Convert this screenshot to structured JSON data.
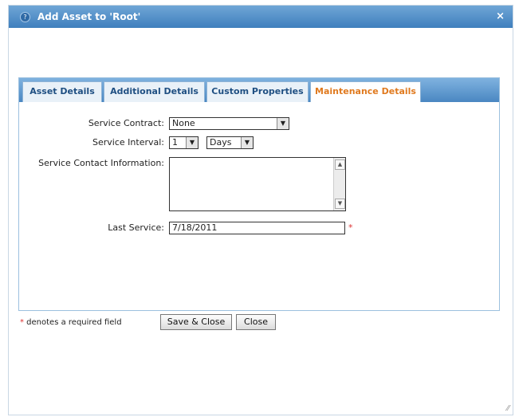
{
  "dialog": {
    "title": "Add Asset to 'Root'",
    "help_icon": "question-circle-icon",
    "close_label": "×"
  },
  "tabs": [
    {
      "label": "Asset Details",
      "active": false
    },
    {
      "label": "Additional Details",
      "active": false
    },
    {
      "label": "Custom Properties",
      "active": false
    },
    {
      "label": "Maintenance Details",
      "active": true
    }
  ],
  "form": {
    "service_contract": {
      "label": "Service Contract:",
      "value": "None"
    },
    "service_interval": {
      "label": "Service Interval:",
      "value": "1",
      "unit": "Days"
    },
    "service_contact": {
      "label": "Service Contact Information:",
      "value": ""
    },
    "last_service": {
      "label": "Last Service:",
      "value": "7/18/2011",
      "required_mark": "*"
    }
  },
  "footer": {
    "required_star": "*",
    "required_note": " denotes a required field",
    "save_close_label": "Save & Close",
    "close_label": "Close"
  },
  "colors": {
    "accent": "#e07a1f",
    "header": "#4a87c2",
    "required": "#dd3333"
  }
}
